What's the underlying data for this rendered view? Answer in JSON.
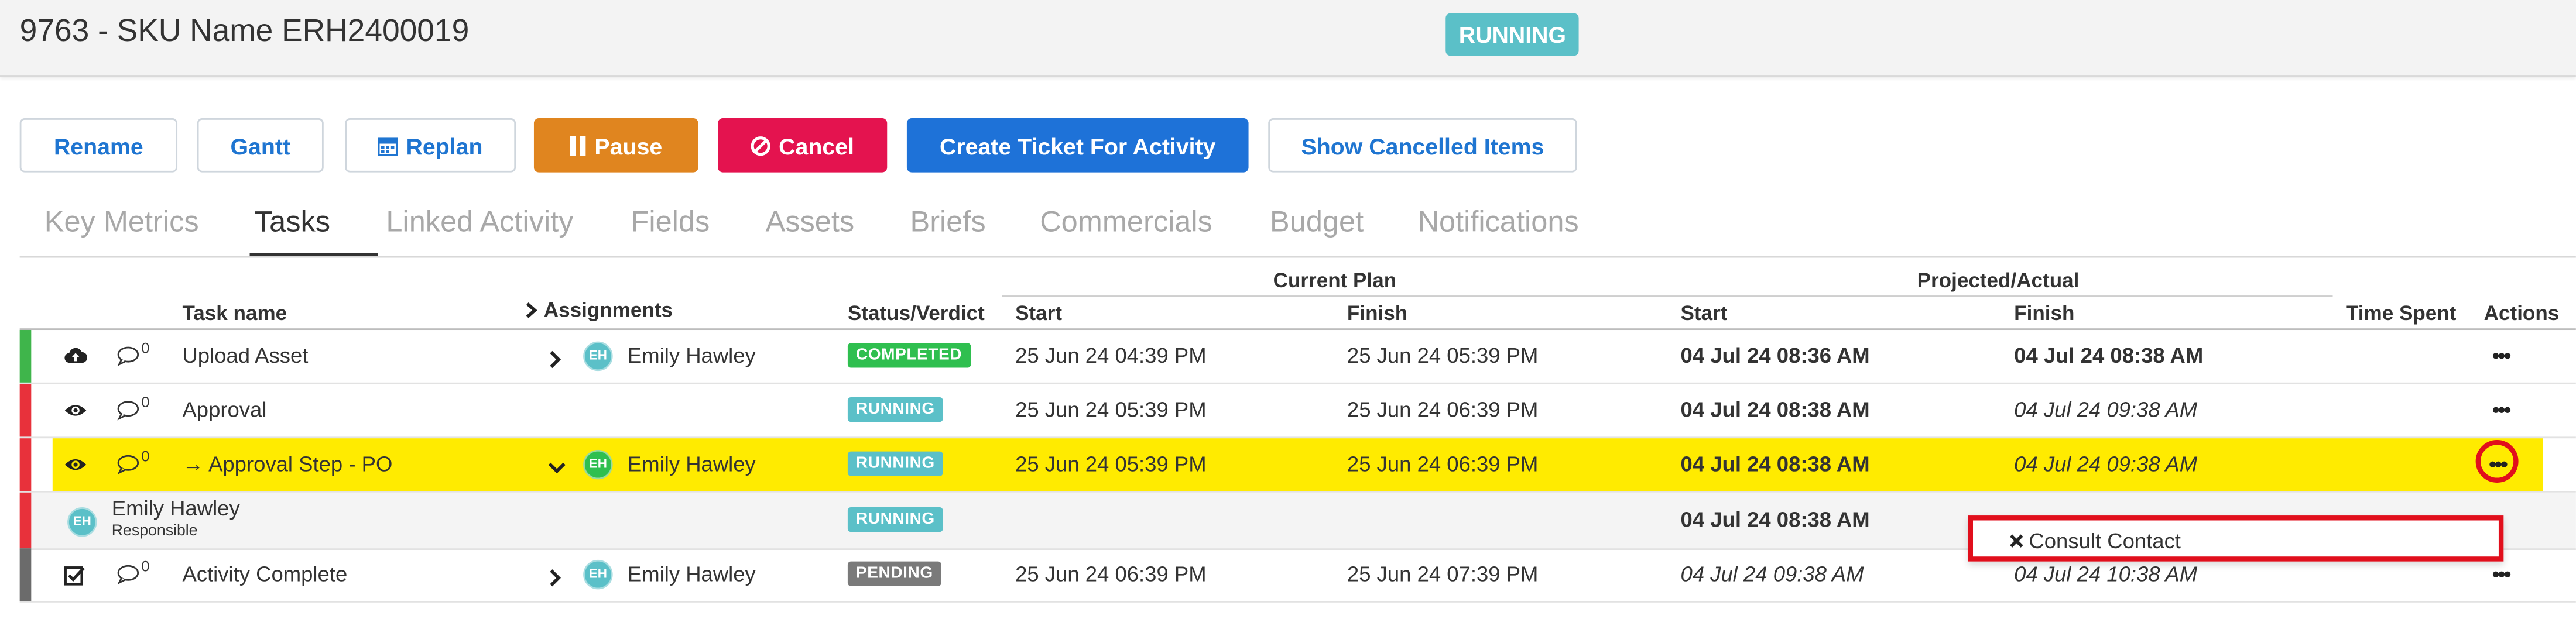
{
  "header": {
    "title": "9763 - SKU Name ERH2400019",
    "status": "RUNNING"
  },
  "toolbar": {
    "rename": "Rename",
    "gantt": "Gantt",
    "replan": "Replan",
    "pause": "Pause",
    "cancel": "Cancel",
    "create_ticket": "Create Ticket For Activity",
    "show_cancelled": "Show Cancelled Items"
  },
  "tabs": [
    "Key Metrics",
    "Tasks",
    "Linked Activity",
    "Fields",
    "Assets",
    "Briefs",
    "Commercials",
    "Budget",
    "Notifications"
  ],
  "active_tab": "Tasks",
  "table": {
    "group_current": "Current Plan",
    "group_projected": "Projected/Actual",
    "headers": {
      "task_name": "Task name",
      "assignments": "Assignments",
      "status": "Status/Verdict",
      "cp_start": "Start",
      "cp_finish": "Finish",
      "pa_start": "Start",
      "pa_finish": "Finish",
      "time_spent": "Time Spent",
      "actions": "Actions"
    },
    "rows": [
      {
        "icon": "cloud-upload-icon",
        "comments": "0",
        "name": "Upload Asset",
        "assignee": "Emily Hawley",
        "avatar": "EH",
        "status": "COMPLETED",
        "cp_start": "25 Jun 24 04:39 PM",
        "cp_finish": "25 Jun 24 05:39 PM",
        "pa_start": "04 Jul 24 08:36 AM",
        "pa_finish": "04 Jul 24 08:38 AM",
        "actions": "•••"
      },
      {
        "icon": "eye-icon",
        "comments": "0",
        "name": "Approval",
        "status": "RUNNING",
        "cp_start": "25 Jun 24 05:39 PM",
        "cp_finish": "25 Jun 24 06:39 PM",
        "pa_start": "04 Jul 24 08:38 AM",
        "pa_finish": "04 Jul 24 09:38 AM",
        "actions": "•••"
      },
      {
        "icon": "eye-icon",
        "comments": "0",
        "name": "→ Approval Step - PO",
        "assignee": "Emily Hawley",
        "avatar": "EH",
        "status": "RUNNING",
        "cp_start": "25 Jun 24 05:39 PM",
        "cp_finish": "25 Jun 24 06:39 PM",
        "pa_start": "04 Jul 24 08:38 AM",
        "pa_finish": "04 Jul 24 09:38 AM",
        "actions": "•••"
      },
      {
        "avatar": "EH",
        "name": "Emily Hawley",
        "role": "Responsible",
        "status": "RUNNING",
        "pa_start": "04 Jul 24 08:38 AM"
      },
      {
        "icon": "checkbox-icon",
        "comments": "0",
        "name": "Activity Complete",
        "assignee": "Emily Hawley",
        "avatar": "EH",
        "status": "PENDING",
        "cp_start": "25 Jun 24 06:39 PM",
        "cp_finish": "25 Jun 24 07:39 PM",
        "pa_start": "04 Jul 24 09:38 AM",
        "pa_finish": "04 Jul 24 10:38 AM",
        "actions": "•••"
      }
    ]
  },
  "context_menu": {
    "item": "Consult Contact"
  },
  "colors": {
    "running": "#5bc0c8",
    "completed": "#2fbf4f",
    "pending": "#7a7a7a",
    "highlight": "#ffeb00",
    "bar_green": "#3fb54b",
    "bar_red": "#e8313b",
    "bar_gray": "#6b6b6b"
  }
}
